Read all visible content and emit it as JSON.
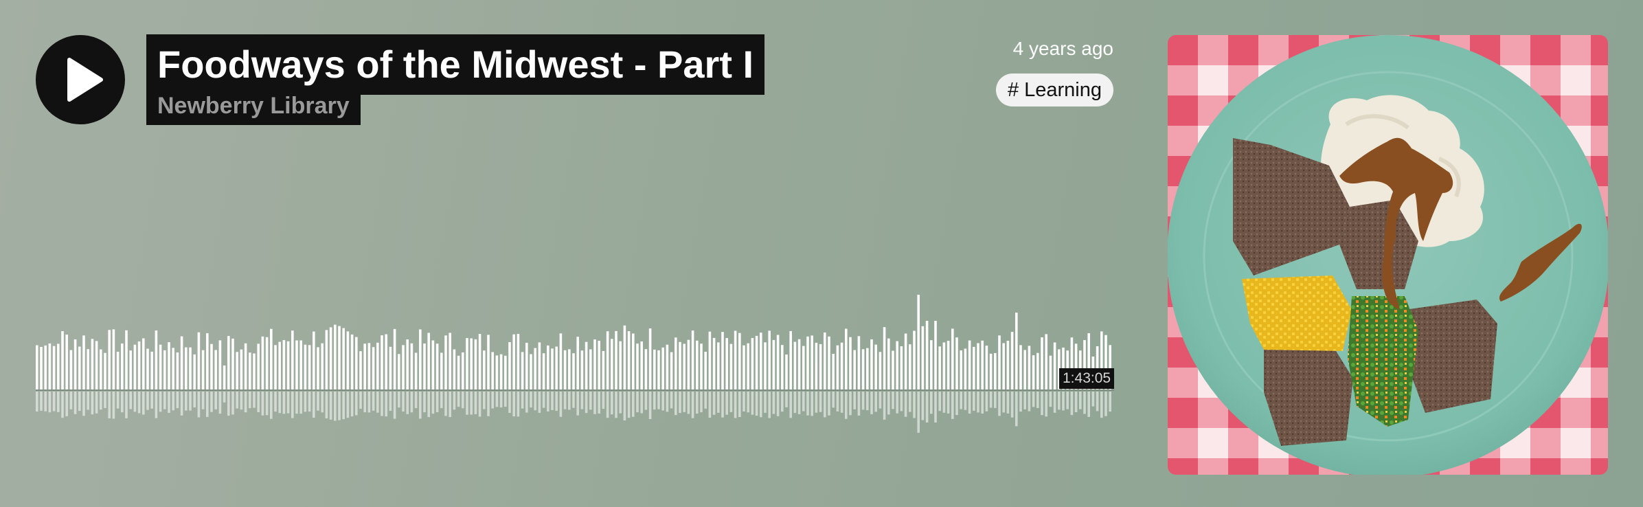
{
  "track": {
    "title": "Foodways of the Midwest - Part I",
    "artist": "Newberry Library",
    "posted": "4 years ago",
    "tag": "# Learning",
    "duration": "1:43:05",
    "progress": 0
  },
  "icons": {
    "play": "play-icon"
  },
  "colors": {
    "background": "#97a898",
    "label_background": "#111111",
    "waveform": "#ffffff",
    "tag_background": "#f2f2f2"
  },
  "artwork": {
    "subject": "plate with Great Lakes shaped meat, mashed potatoes, gravy, corn and mixed vegetables on gingham cloth"
  }
}
